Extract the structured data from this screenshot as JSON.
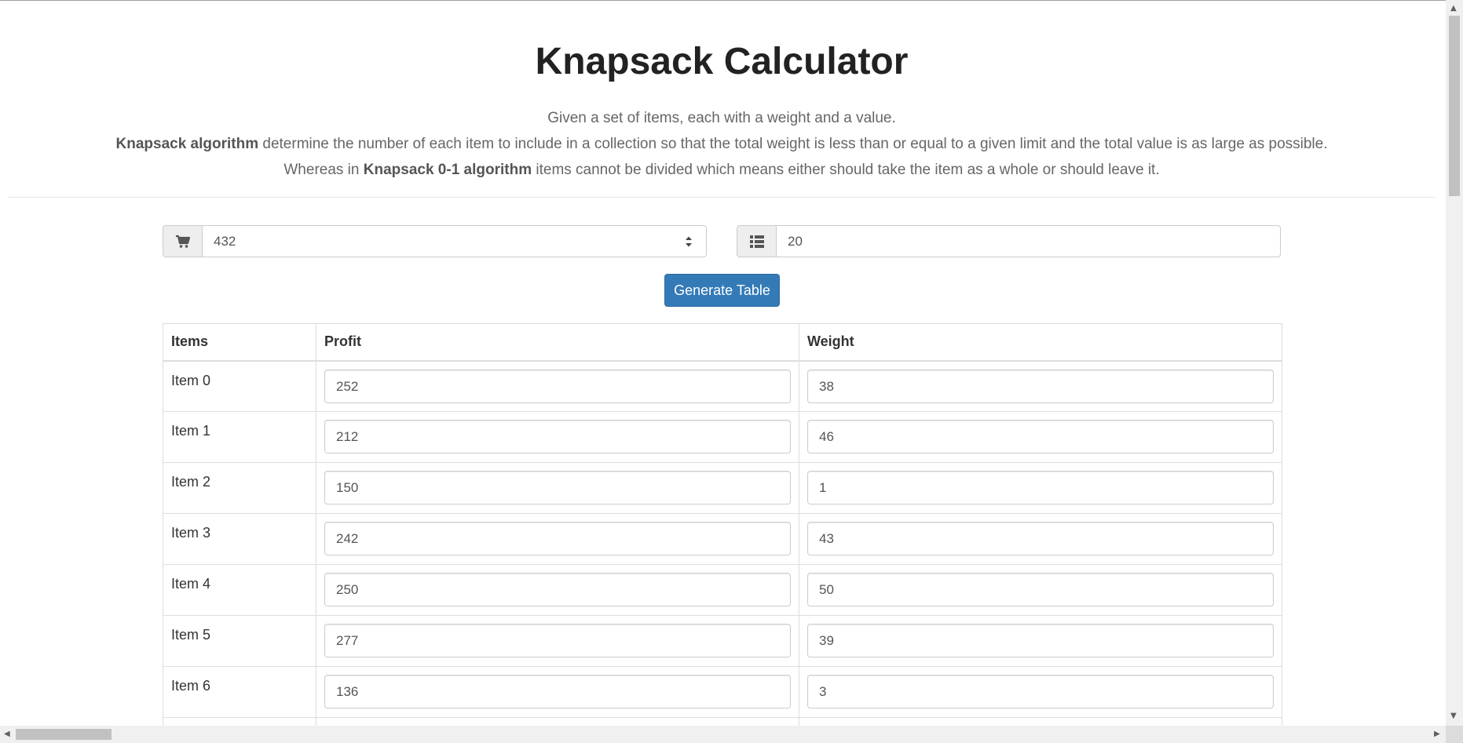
{
  "title": "Knapsack Calculator",
  "description": {
    "line1": "Given a set of items, each with a weight and a value.",
    "line2_bold": "Knapsack algorithm",
    "line2_rest": " determine the number of each item to include in a collection so that the total weight is less than or equal to a given limit and the total value is as large as possible.",
    "line3_pre": "Whereas in ",
    "line3_bold": "Knapsack 0-1 algorithm",
    "line3_rest": " items cannot be divided which means either should take the item as a whole or should leave it."
  },
  "capacity_input": {
    "icon": "cart-icon",
    "value": "432"
  },
  "items_input": {
    "icon": "list-icon",
    "value": "20"
  },
  "generate_button": {
    "label": "Generate Table",
    "color": "#337ab7"
  },
  "table": {
    "headers": [
      "Items",
      "Profit",
      "Weight"
    ],
    "rows": [
      {
        "item": "Item 0",
        "profit": "252",
        "weight": "38"
      },
      {
        "item": "Item 1",
        "profit": "212",
        "weight": "46"
      },
      {
        "item": "Item 2",
        "profit": "150",
        "weight": "1"
      },
      {
        "item": "Item 3",
        "profit": "242",
        "weight": "43"
      },
      {
        "item": "Item 4",
        "profit": "250",
        "weight": "50"
      },
      {
        "item": "Item 5",
        "profit": "277",
        "weight": "39"
      },
      {
        "item": "Item 6",
        "profit": "136",
        "weight": "3"
      },
      {
        "item": "",
        "profit": "",
        "weight": ""
      }
    ]
  }
}
